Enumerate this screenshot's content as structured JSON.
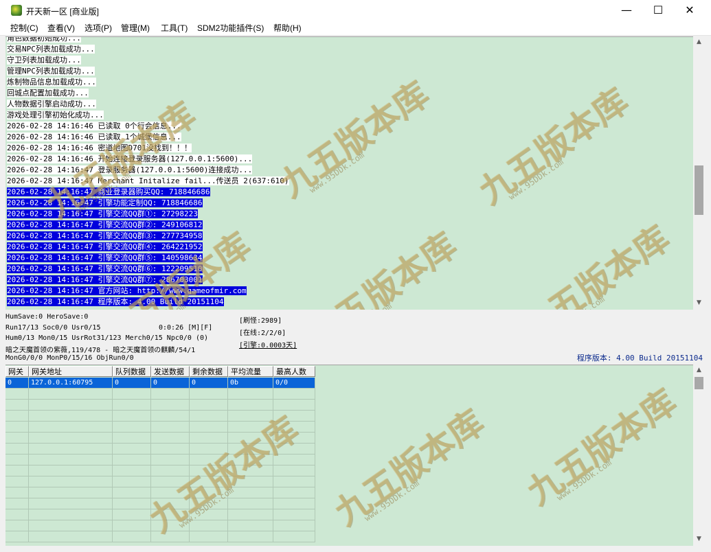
{
  "window": {
    "title": "开天新一区 [商业版]"
  },
  "controls": {
    "minimize": "—",
    "maximize": "☐",
    "close": "✕"
  },
  "menu": [
    {
      "label": "控制(C)"
    },
    {
      "label": "查看(V)"
    },
    {
      "label": "选项(P)"
    },
    {
      "label": "管理(M)"
    },
    {
      "label": "工具(T)"
    },
    {
      "label": "SDM2功能插件(S)"
    },
    {
      "label": "帮助(H)"
    }
  ],
  "log": [
    {
      "text": "角色数据初始成功..."
    },
    {
      "text": "交易NPC列表加载成功..."
    },
    {
      "text": "守卫列表加载成功..."
    },
    {
      "text": "管理NPC列表加载成功..."
    },
    {
      "text": "炼制物品信息加载成功..."
    },
    {
      "text": "回城点配置加载成功..."
    },
    {
      "text": "人物数据引擎启动成功..."
    },
    {
      "text": "游戏处理引擎初始化成功..."
    },
    {
      "text": "2026-02-28 14:16:46 已读取 0个行会信息..."
    },
    {
      "text": "2026-02-28 14:16:46 已读取 1个城堡信息..."
    },
    {
      "text": "2026-02-28 14:16:46 密道地图D701没找到！！！"
    },
    {
      "text": "2026-02-28 14:16:46 开始连接登录服务器(127.0.0.1:5600)..."
    },
    {
      "text": "2026-02-28 14:16:47 登录服务器(127.0.0.1:5600)连接成功..."
    },
    {
      "text": "2026-02-28 14:16:47 Merchant Initalize fail...传送员 2(637:610)"
    },
    {
      "text": "2026-02-28 14:16:47 商业登录器购买QQ: 718846686",
      "sel": true
    },
    {
      "text": "2026-02-28 14:16:47 引擎功能定制QQ: 718846686",
      "sel": true
    },
    {
      "text": "2026-02-28 14:16:47 引擎交流QQ群①: 27298223",
      "sel": true
    },
    {
      "text": "2026-02-28 14:16:47 引擎交流QQ群②: 249106812",
      "sel": true
    },
    {
      "text": "2026-02-28 14:16:47 引擎交流QQ群③: 277734958",
      "sel": true
    },
    {
      "text": "2026-02-28 14:16:47 引擎交流QQ群④: 264221952",
      "sel": true
    },
    {
      "text": "2026-02-28 14:16:47 引擎交流QQ群⑤: 140598634",
      "sel": true
    },
    {
      "text": "2026-02-28 14:16:47 引擎交流QQ群⑥: 122209510",
      "sel": true
    },
    {
      "text": "2026-02-28 14:16:47 引擎交流QQ群⑦: 286703001",
      "sel": true
    },
    {
      "text": "2026-02-28 14:16:47 官方网站: http://www.gameofmir.com",
      "sel": true
    },
    {
      "text": "2026-02-28 14:16:47 程序版本: 4.00 Build 20151104",
      "sel": true
    }
  ],
  "status": {
    "line1": "HumSave:0 HeroSave:0",
    "line2": "Run17/13 Soc0/0 Usr0/15",
    "line2b": "0:0:26 [M][F]",
    "line3": "Hum0/13 Mon0/15 UsrRot31/123 Merch0/15 Npc0/0 (0)",
    "line4": "暗之天魔首领の紫薇,119/478 - 暗之天魔首领の麒麟/54/1",
    "line5": "MonG0/0/0 MonP0/15/16 ObjRun0/0",
    "refresh": "[刷怪:2989]",
    "online": "[在线:2/2/0]",
    "engine": "[引擎:0.0003天]",
    "version": "程序版本: 4.00 Build 20151104"
  },
  "grid": {
    "headers": [
      "网关",
      "网关地址",
      "队列数据",
      "发送数据",
      "剩余数据",
      "平均流量",
      "最高人数"
    ],
    "rows": [
      [
        "0",
        "127.0.0.1:60795",
        "0",
        "0",
        "0",
        "0b",
        "0/0"
      ]
    ]
  },
  "watermark": {
    "text": "九五版本库",
    "url": "www.95DDk.com"
  }
}
